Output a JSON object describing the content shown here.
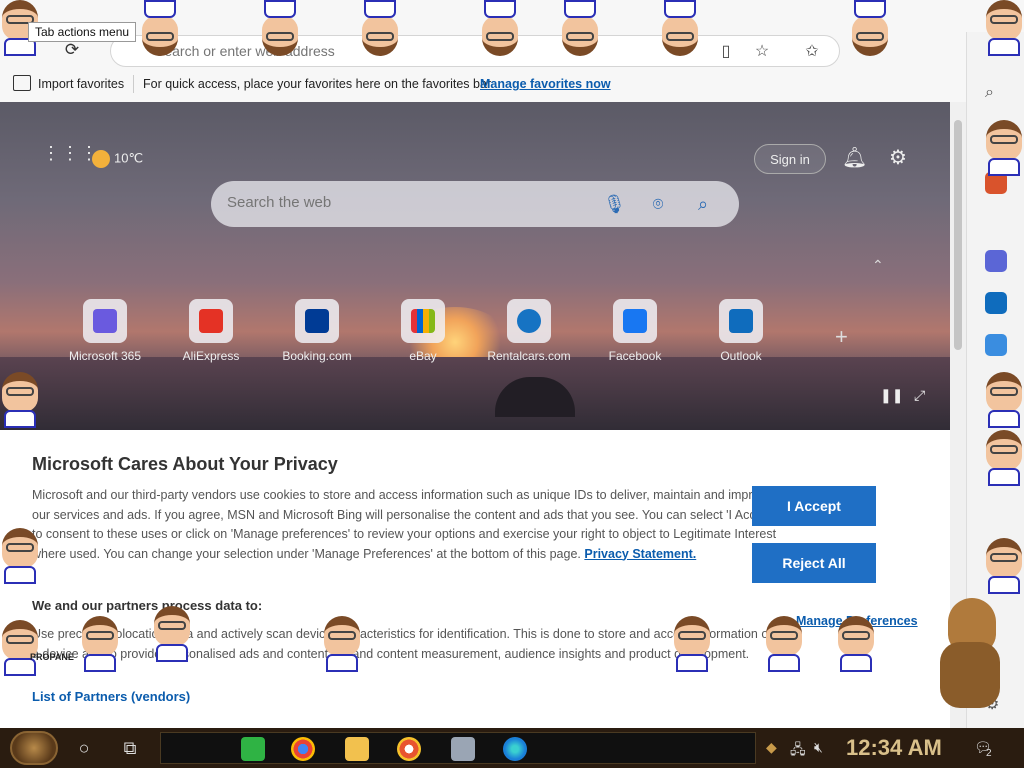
{
  "browser": {
    "tooltip": "Tab actions menu",
    "address_placeholder": "Search or enter web address",
    "favorites_bar": {
      "import": "Import favorites",
      "message": "For quick access, place your favorites here on the favorites bar.",
      "manage_link": "Manage favorites now"
    }
  },
  "newtab": {
    "weather": "10℃",
    "sign_in": "Sign in",
    "search_placeholder": "Search the web",
    "tiles": [
      {
        "label": "Microsoft 365",
        "color": "#6a5adf"
      },
      {
        "label": "AliExpress",
        "color": "#e43225"
      },
      {
        "label": "Booking.com",
        "color": "#003b95"
      },
      {
        "label": "eBay",
        "color": "#2b2b2b"
      },
      {
        "label": "Rentalcars.com",
        "color": "#1673c3"
      },
      {
        "label": "Facebook",
        "color": "#1877f2"
      },
      {
        "label": "Outlook",
        "color": "#0f6cbd"
      }
    ]
  },
  "privacy": {
    "title": "Microsoft Cares About Your Privacy",
    "paragraph": "Microsoft and our third-party vendors use cookies to store and access information such as unique IDs to deliver, maintain and improve our services and ads. If you agree, MSN and Microsoft Bing will personalise the content and ads that you see. You can select 'I Accept' to consent to these uses or click on 'Manage preferences' to review your options and exercise your right to object to Legitimate Interest where used. You can change your selection under 'Manage Preferences' at the bottom of this page.",
    "statement_link": "Privacy Statement.",
    "subtitle": "We and our partners process data to:",
    "paragraph2": "Use precise geolocation data and actively scan device characteristics for identification. This is done to store and access information on a device and to provide personalised ads and content, ad and content measurement, audience insights and product development.",
    "list_link": "List of Partners (vendors)",
    "manage_link": "Manage Preferences",
    "accept": "I Accept",
    "reject": "Reject All"
  },
  "taskbar": {
    "time": "12:34 AM",
    "notification_count": "2"
  },
  "overlay": {
    "sticker_text": "PROPANE"
  },
  "colors": {
    "accent": "#1f6fc5",
    "link": "#0b5cad",
    "taskbar": "#2a1c10",
    "clock": "#d9c08a"
  }
}
